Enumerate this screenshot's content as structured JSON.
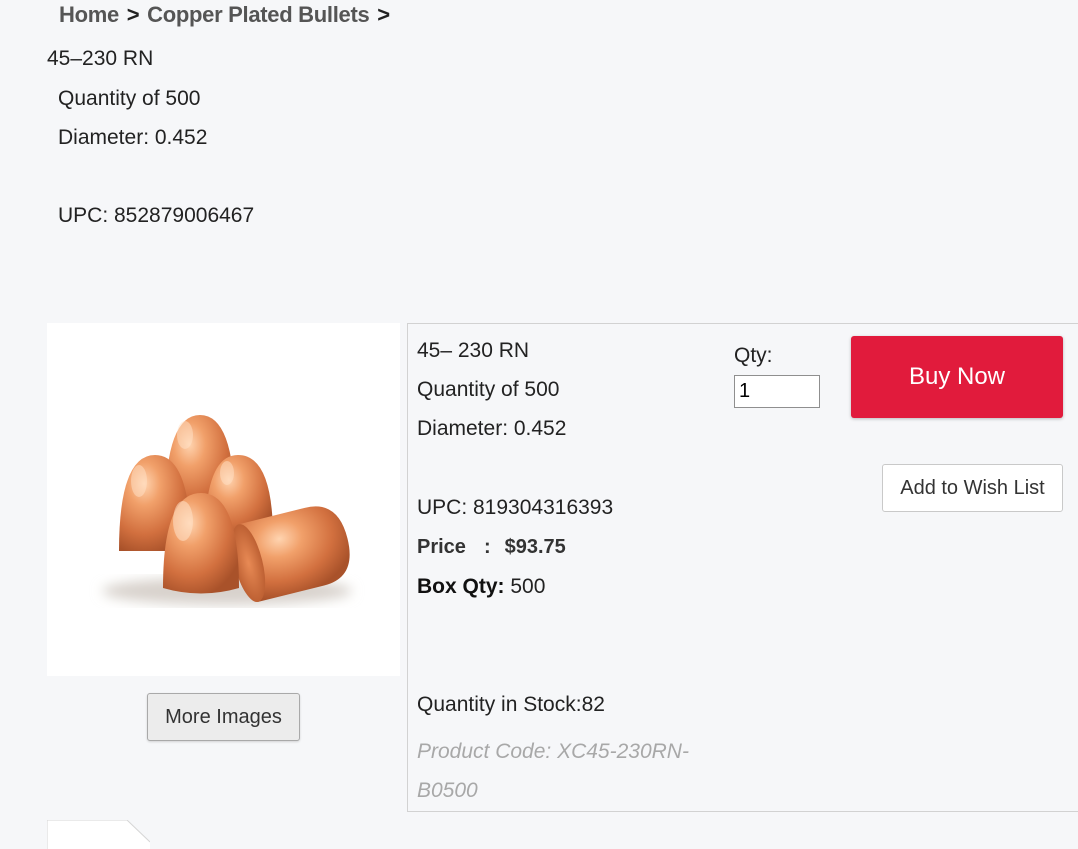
{
  "breadcrumb": {
    "home": "Home",
    "sep1": ">",
    "category": "Copper Plated Bullets",
    "sep2": ">"
  },
  "header_block": {
    "title": "45–230 RN",
    "quantity": "Quantity of 500",
    "diameter": "Diameter: 0.452",
    "upc": "UPC: 852879006467"
  },
  "image": {
    "icon": "copper-bullets-photo",
    "more_images_label": "More Images"
  },
  "product": {
    "title": "45– 230 RN",
    "quantity": "Quantity of 500",
    "diameter": "Diameter: 0.452",
    "upc": "UPC: 819304316393",
    "price_label": "Price",
    "price_colon": ":",
    "price_value": "$93.75",
    "box_qty_label": "Box Qty:",
    "box_qty_value": "500",
    "stock": "Quantity in Stock:82",
    "product_code": "Product Code: XC45-230RN-B0500"
  },
  "actions": {
    "qty_label": "Qty:",
    "qty_value": "1",
    "buy_now": "Buy Now",
    "wish_list": "Add to Wish List"
  },
  "colors": {
    "buy_now_bg": "#e11b3c",
    "copper": "#d9794a"
  }
}
